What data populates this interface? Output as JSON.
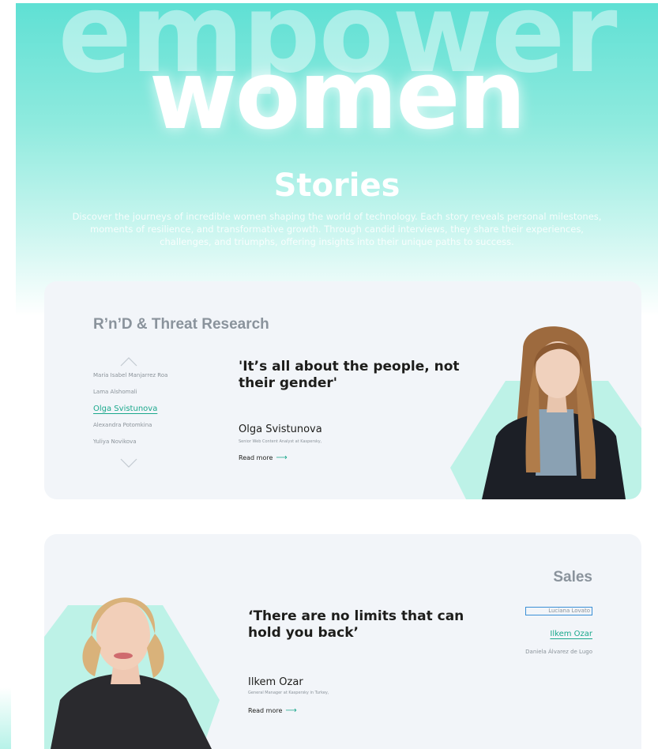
{
  "hero": {
    "word_top": "empower",
    "word_main": "women",
    "title": "Stories",
    "description": "Discover the journeys of incredible women shaping the world of technology. Each story reveals personal milestones, moments of resilience, and transformative growth. Through candid interviews, they share their experiences, challenges, and triumphs, offering insights into their unique paths to success."
  },
  "story1": {
    "department": "R’n’D & Threat Research",
    "names": [
      "Maria Isabel Manjarrez Roa",
      "Lama Alshomali",
      "Olga Svistunova",
      "Alexandra Potomkina",
      "Yuliya Novikova"
    ],
    "active_index": 2,
    "quote": "'It’s all about the people, not their gender'",
    "person_name": "Olga Svistunova",
    "person_role": "Senior Web Content Analyst at Kaspersky,",
    "read_more": "Read more",
    "arrow": "⟶"
  },
  "story2": {
    "department": "Sales",
    "names": [
      "Luciana Lovato",
      "Ilkem Ozar",
      "Daniela Álvarez de Lugo"
    ],
    "active_index": 1,
    "quote": "‘There are no limits that can hold you back’",
    "person_name": "Ilkem Ozar",
    "person_role": "General Manager at Kaspersky in Turkey,",
    "read_more": "Read more",
    "arrow": "⟶"
  },
  "colors": {
    "accent": "#1aa88c",
    "hero_teal": "#5fe0d4",
    "card_bg": "#f2f5f9",
    "muted_text": "#8b939a",
    "mint_shape": "#bdf2e7"
  }
}
